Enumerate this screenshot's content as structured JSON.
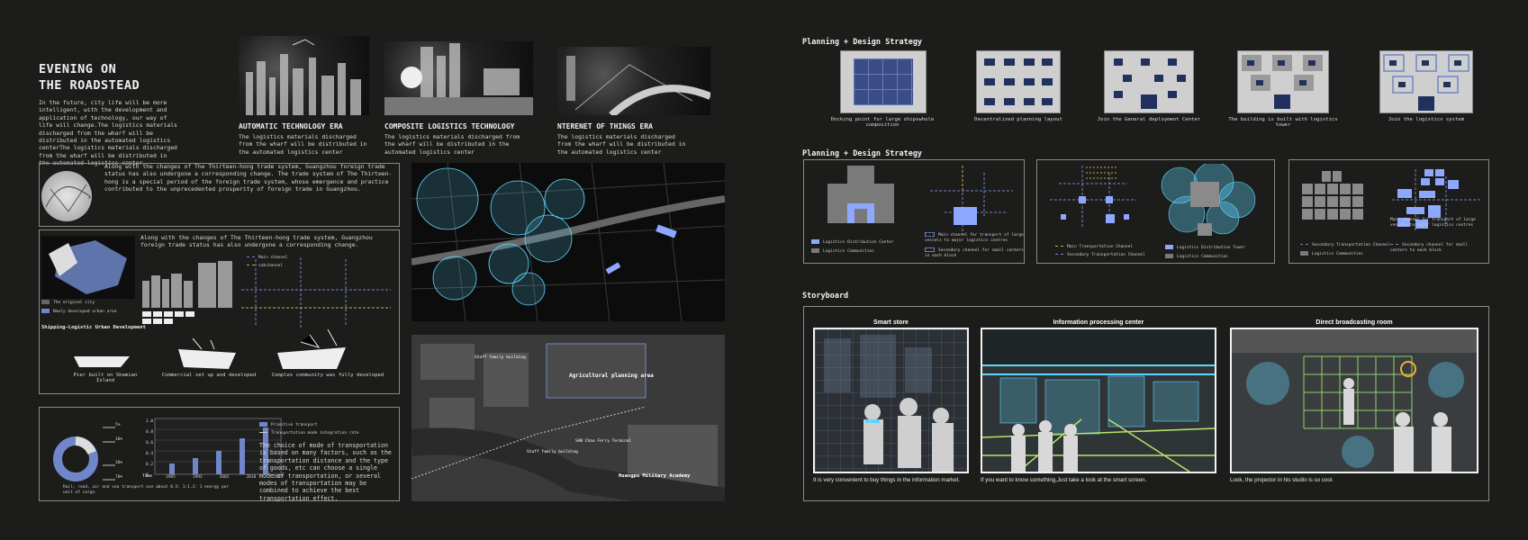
{
  "left": {
    "title_line1": "EVENING ON",
    "title_line2": "THE ROADSTEAD",
    "intro": "In the future, city life will be more intelligent, with the development and application of technology, our way of life will change.The logistics materials discharged from the wharf will be distributed in the automated logistics centerThe logistics materials discharged from the wharf will be distributed in the automated logistics center",
    "eras": [
      {
        "title": "AUTOMATIC TECHNOLOGY ERA",
        "text": "The logistics materials discharged from the wharf will be distributed in the automated logistics center"
      },
      {
        "title": "COMPOSITE LOGISTICS TECHNOLOGY",
        "text": "The logistics materials discharged from the wharf will be distributed in the automated logistics center"
      },
      {
        "title": "NTERENET OF THINGS ERA",
        "text": "The logistics materials discharged from the wharf will be distributed in the automated logistics center"
      }
    ],
    "panel1_text": "Along with the changes of The Thirteen-hong trade system, Guangzhou foreign trade status has also undergone a corresponding change. The trade system of The Thirteen-hong is a special period of the foreign trade system, whose emergence and practice contributed to the unprecedented prosperity of foreign trade in Guangzhou.",
    "panel2_text": "Along with the changes of The Thirteen-hong trade system, Guangzhou foreign trade status has also undergone a corresponding change.",
    "panel2_legend": [
      "The original city",
      "Newly developed urban area"
    ],
    "panel2_channels": [
      "Main channel",
      "subchannel"
    ],
    "panel2_heading": "Shipping-Logistic Urban Development",
    "panel2_captions": [
      "Pier built on Shamian Island",
      "Commercial set up and developed",
      "Complex community was fully developed"
    ],
    "panel3": {
      "donut_labels": [
        "5%",
        "10%",
        "30%",
        "70%"
      ],
      "donut_caption": "Rail, road, air and sea transport use about 0.5: 1:1.2: 1 energy per unit of cargo.",
      "legend": [
        "Primitive transport",
        "Transportation mode integration rate"
      ],
      "axis_ticks": [
        "1.0",
        "0.8",
        "0.6",
        "0.4",
        "0.2",
        "0"
      ],
      "xlabel": "Time",
      "years": [
        "1985",
        "1993",
        "2002",
        "2010",
        "2017"
      ],
      "text": "The choice of mode of transportation is based on many factors, such as the transportation distance and the type of goods, etc can choose a single mode of transportation, or several modes of transportation may be combined to achieve the best transportation effect."
    },
    "map_labels": [
      "Staff family building",
      "Agricultural planning area",
      "Staff family building",
      "SAN Chao Ferry Terminal",
      "Huangpu Military Academy"
    ]
  },
  "right": {
    "section1_title": "Planning + Design Strategy",
    "strategies": [
      "Docking point for large shipswhole composition",
      "Decentralized planning layout",
      "Join the General deployment Center",
      "The building is built with logistics tower",
      "Join the logistics system"
    ],
    "section2_title": "Planning + Design Strategy",
    "box1_legend": [
      "Logistics Distribution Center",
      "Logistics Communities"
    ],
    "box1_legend_b": [
      "Main channel for transport of large vessels to major logistics centres",
      "Secondary channel for small centers in each block"
    ],
    "box2_legend": [
      "Main Transportation Channel",
      "Secondary Transportation Channel"
    ],
    "box2_legend_b": [
      "Logistics Distribution Tower",
      "Logistics Communities"
    ],
    "box3_legend": [
      "Secondary Transportation Channel",
      "Logistics Communities"
    ],
    "box3_legend_b": [
      "Main channel for transport of large vessels to major logistics centres",
      "Secondary channel for small centers to each block"
    ],
    "storyboard_title": "Storyboard",
    "scenes": [
      {
        "title": "Smart store",
        "caption": "It is very convenient to buy things in the information market."
      },
      {
        "title": "Information processing center",
        "caption": "If you want to know something,Just take a look at the smart screen."
      },
      {
        "title": "Direct broadcasting room",
        "caption": "Look, the projector in his studio is so cool."
      }
    ]
  },
  "colors": {
    "background": "#1c1c1a",
    "accent_blue": "#5a6fb6",
    "light_blue": "#8fa8ff",
    "cyan": "#5fd6ff",
    "border": "#8a8a86"
  }
}
